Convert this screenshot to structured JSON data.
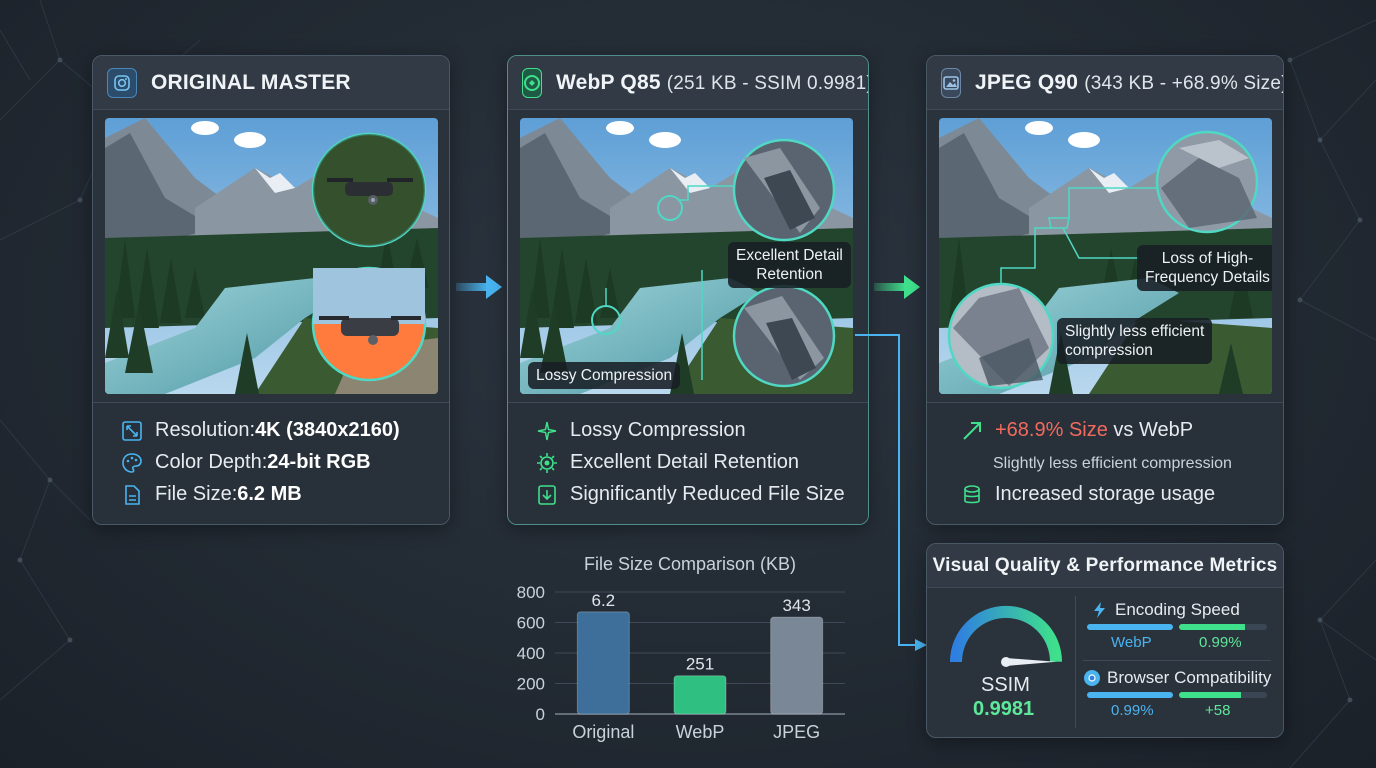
{
  "colors": {
    "accent_blue": "#49b4f0",
    "accent_green": "#3fe08c",
    "accent_red": "#f26a5e",
    "ssim_green": "#5ee89a"
  },
  "original": {
    "icon": "camera-icon",
    "title": "ORIGINAL MASTER",
    "features": [
      {
        "icon": "resolution-icon",
        "label": "Resolution: ",
        "value": "4K (3840x2160)"
      },
      {
        "icon": "palette-icon",
        "label": "Color Depth: ",
        "value": "24-bit RGB"
      },
      {
        "icon": "file-icon",
        "label": "File Size: ",
        "value": "6.2 MB"
      }
    ]
  },
  "webp": {
    "icon": "webp-logo-icon",
    "title": "WebP Q85",
    "subtitle": "(251 KB - SSIM 0.9981)",
    "callouts": {
      "detail": [
        "Excellent Detail",
        "Retention"
      ],
      "lossy": "Lossy Compression"
    },
    "features": [
      {
        "icon": "sparkle-icon",
        "label": "Lossy Compression"
      },
      {
        "icon": "detail-gear-icon",
        "label": "Excellent Detail Retention"
      },
      {
        "icon": "download-file-icon",
        "label": "Significantly Reduced File Size"
      }
    ]
  },
  "jpeg": {
    "icon": "image-icon",
    "title": "JPEG Q90",
    "subtitle": "(343 KB - +68.9% Size)",
    "callouts": {
      "loss": [
        "Loss of High-",
        "Frequency Details"
      ],
      "efficiency": [
        "Slightly less efficient",
        "compression"
      ]
    },
    "size_delta": "+68.9% Size",
    "size_delta_suffix": " vs WebP",
    "efficiency_note": "Slightly less efficient compression",
    "storage_note": "Increased storage usage"
  },
  "chart_data": {
    "type": "bar",
    "title": "File Size Comparison (KB)",
    "categories": [
      "Original",
      "WebP",
      "JPEG"
    ],
    "values": [
      670,
      251,
      635
    ],
    "data_labels": [
      "6.2",
      "251",
      "343"
    ],
    "ylim": [
      0,
      800
    ],
    "yticks": [
      0,
      200,
      400,
      600,
      800
    ],
    "grid": true,
    "bar_colors": [
      "#3d6f9a",
      "#2fbf80",
      "#7a8796"
    ]
  },
  "metrics": {
    "title": "Visual Quality & Performance Metrics",
    "gauge_label": "SSIM",
    "gauge_value": "0.9981",
    "gauge_fraction": 0.9981,
    "encoding": {
      "icon": "lightning-icon",
      "label": "Encoding Speed",
      "left_value": "WebP",
      "right_value": "0.99%",
      "left_fill": 1.0,
      "right_fill": 0.75
    },
    "compat": {
      "icon": "chrome-icon",
      "label": "Browser Compatibility",
      "left_value": "0.99%",
      "right_value": "+58",
      "left_fill": 1.0,
      "right_fill": 0.7
    }
  }
}
